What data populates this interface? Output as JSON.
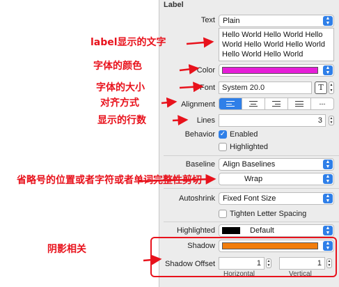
{
  "inspector": {
    "section_title": "Label",
    "text": {
      "label": "Text",
      "value": "Plain"
    },
    "content": "Hello World Hello World Hello World Hello World Hello World Hello World Hello World",
    "color": {
      "label": "Color",
      "swatch": "#e61ed8"
    },
    "font": {
      "label": "Font",
      "value": "System 20.0"
    },
    "alignment": {
      "label": "Alignment",
      "options": [
        "left",
        "center",
        "right",
        "justified",
        "natural"
      ],
      "selected": "left",
      "natural_glyph": "---"
    },
    "lines": {
      "label": "Lines",
      "value": "3"
    },
    "behavior": {
      "label": "Behavior",
      "enabled": {
        "label": "Enabled",
        "checked": true
      },
      "highlighted": {
        "label": "Highlighted",
        "checked": false
      }
    },
    "baseline": {
      "label": "Baseline",
      "value": "Align Baselines"
    },
    "line_breaks": {
      "value": "Wrap"
    },
    "autoshrink": {
      "label": "Autoshrink",
      "value": "Fixed Font Size"
    },
    "tighten": {
      "label": "Tighten Letter Spacing",
      "checked": false
    },
    "highlighted_color": {
      "label": "Highlighted",
      "value": "Default",
      "swatch": "#000000"
    },
    "shadow": {
      "label": "Shadow",
      "swatch": "#f27d0c"
    },
    "shadow_offset": {
      "label": "Shadow Offset",
      "horizontal": "1",
      "vertical": "1",
      "horizontal_label": "Horizontal",
      "vertical_label": "Vertical"
    }
  },
  "annotations": {
    "label_text": "label显示的文字",
    "font_color": "字体的颜色",
    "font_size": "字体的大小",
    "alignment": "对齐方式",
    "lines": "显示的行数",
    "truncation": "省略号的位置或者字符或者单词完整性剪切",
    "shadow": "阴影相关"
  },
  "colors": {
    "annotation": "#e8121c",
    "accent": "#2f7fe8"
  }
}
